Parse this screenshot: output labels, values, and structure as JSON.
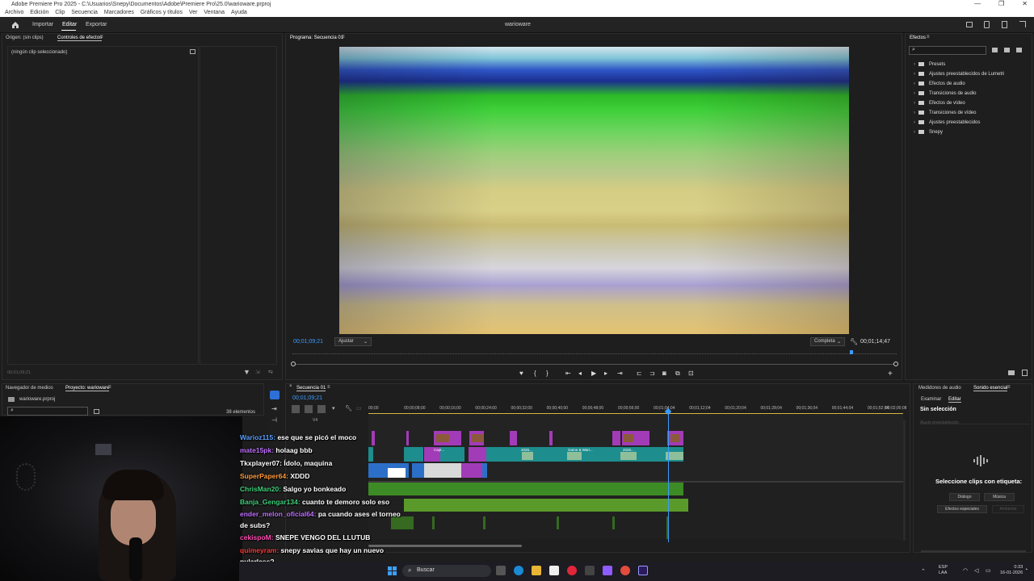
{
  "window": {
    "title": "Adobe Premiere Pro 2025 - C:\\Usuarios\\Snepy\\Documentos\\Adobe\\Premiere Pro\\25.0\\warioware.prproj",
    "controls": [
      "—",
      "❐",
      "✕"
    ]
  },
  "menu": [
    "Archivo",
    "Edición",
    "Clip",
    "Secuencia",
    "Marcadores",
    "Gráficos y títulos",
    "Ver",
    "Ventana",
    "Ayuda"
  ],
  "header": {
    "tabs": [
      "Importar",
      "Editar",
      "Exportar"
    ],
    "active_tab": "Editar",
    "project_title": "warioware"
  },
  "source_panel": {
    "tabs": [
      "Origen: (sin clips)",
      "Controles de efectos"
    ],
    "no_clip": "(ningún clip seleccionado)",
    "timecode": "00;01;09;21"
  },
  "program_panel": {
    "title": "Programa: Secuencia 01",
    "timecode_left": "00;01;09;21",
    "fit": "Ajustar",
    "quality": "Completa",
    "timecode_right": "00;01;14;47"
  },
  "effects_panel": {
    "title": "Efectos",
    "items": [
      "Presets",
      "Ajustes preestablecidos de Lumetri",
      "Efectos de audio",
      "Transiciones de audio",
      "Efectos de vídeo",
      "Transiciones de vídeo",
      "Ajustes preestablecidos",
      "Snepy"
    ]
  },
  "project_panel": {
    "tabs": [
      "Navegador de medios",
      "Proyecto: warioware"
    ],
    "file": "warioware.prproj",
    "count": "38 elementos"
  },
  "timeline": {
    "title": "Secuencia 01",
    "timecode": "00;01;09;21",
    "ruler": [
      "00;00",
      "00;00;08;00",
      "00;00;16;00",
      "00;00;24;00",
      "00;00;32;00",
      "00;00;40;00",
      "00;00;48;00",
      "00;00;56;00",
      "00;01;04;04",
      "00;01;12;04",
      "00;01;20;04",
      "00;01;28;04",
      "00;01;36;04",
      "00;01;44;04",
      "00;01;52;04",
      "00;02;00;08"
    ],
    "track_label": "V4",
    "clip_labels": [
      "Game & Wari...",
      "2026...",
      "Capt...",
      "2026..."
    ]
  },
  "essential_sound": {
    "tabs": [
      "Medidores de audio",
      "Sonido esencial"
    ],
    "subtabs": [
      "Examinar",
      "Editar"
    ],
    "selection": "Sin selección",
    "preset_placeholder": "Ajuste preestablecido",
    "prompt": "Seleccione clips con etiqueta:",
    "buttons": [
      "Diálogo",
      "Música",
      "Efectos especiales",
      "Ambiente"
    ]
  },
  "chat": [
    {
      "user": "Warioz115:",
      "msg": "ese que se picó el moco",
      "color": "#5aa0ff"
    },
    {
      "user": "mate15pk:",
      "msg": "holaag bbb",
      "color": "#c070ff"
    },
    {
      "user": "Tkxplayer07:",
      "msg": "Ídolo, maquina",
      "color": "#ffffff"
    },
    {
      "user": "SuperPaper64:",
      "msg": "XDDD",
      "color": "#ff9b3d"
    },
    {
      "user": "ChrisMan20:",
      "msg": "Salgo yo bonkeado",
      "color": "#3fd07a"
    },
    {
      "user": "Banja_Gengar134:",
      "msg": "cuanto te demoro solo eso",
      "color": "#3fd07a"
    },
    {
      "user": "ender_melon_oficial64:",
      "msg": "pa cuando ases el torneo",
      "color": "#c070ff"
    },
    {
      "user": "",
      "msg": "de subs?",
      "color": "#ffffff"
    },
    {
      "user": "cekispoM:",
      "msg": "SNEPE VENGO DEL LLUTUB",
      "color": "#ff4fb4"
    },
    {
      "user": "quimeyram:",
      "msg": "snepy savias que hay un nuevo",
      "color": "#ff3b3b"
    },
    {
      "user": "",
      "msg": "pularless?",
      "color": "#ffffff"
    }
  ],
  "taskbar": {
    "search": "Buscar",
    "lang": "ESP",
    "lang2": "LAA",
    "time": "0:33",
    "date": "16-01-2026"
  },
  "colors": {
    "accent": "#2d8ceb",
    "clip_purple": "#a23bb7",
    "clip_teal": "#1d8d8e",
    "clip_blue": "#2c6fc8",
    "audio_green": "#3d8b25"
  }
}
